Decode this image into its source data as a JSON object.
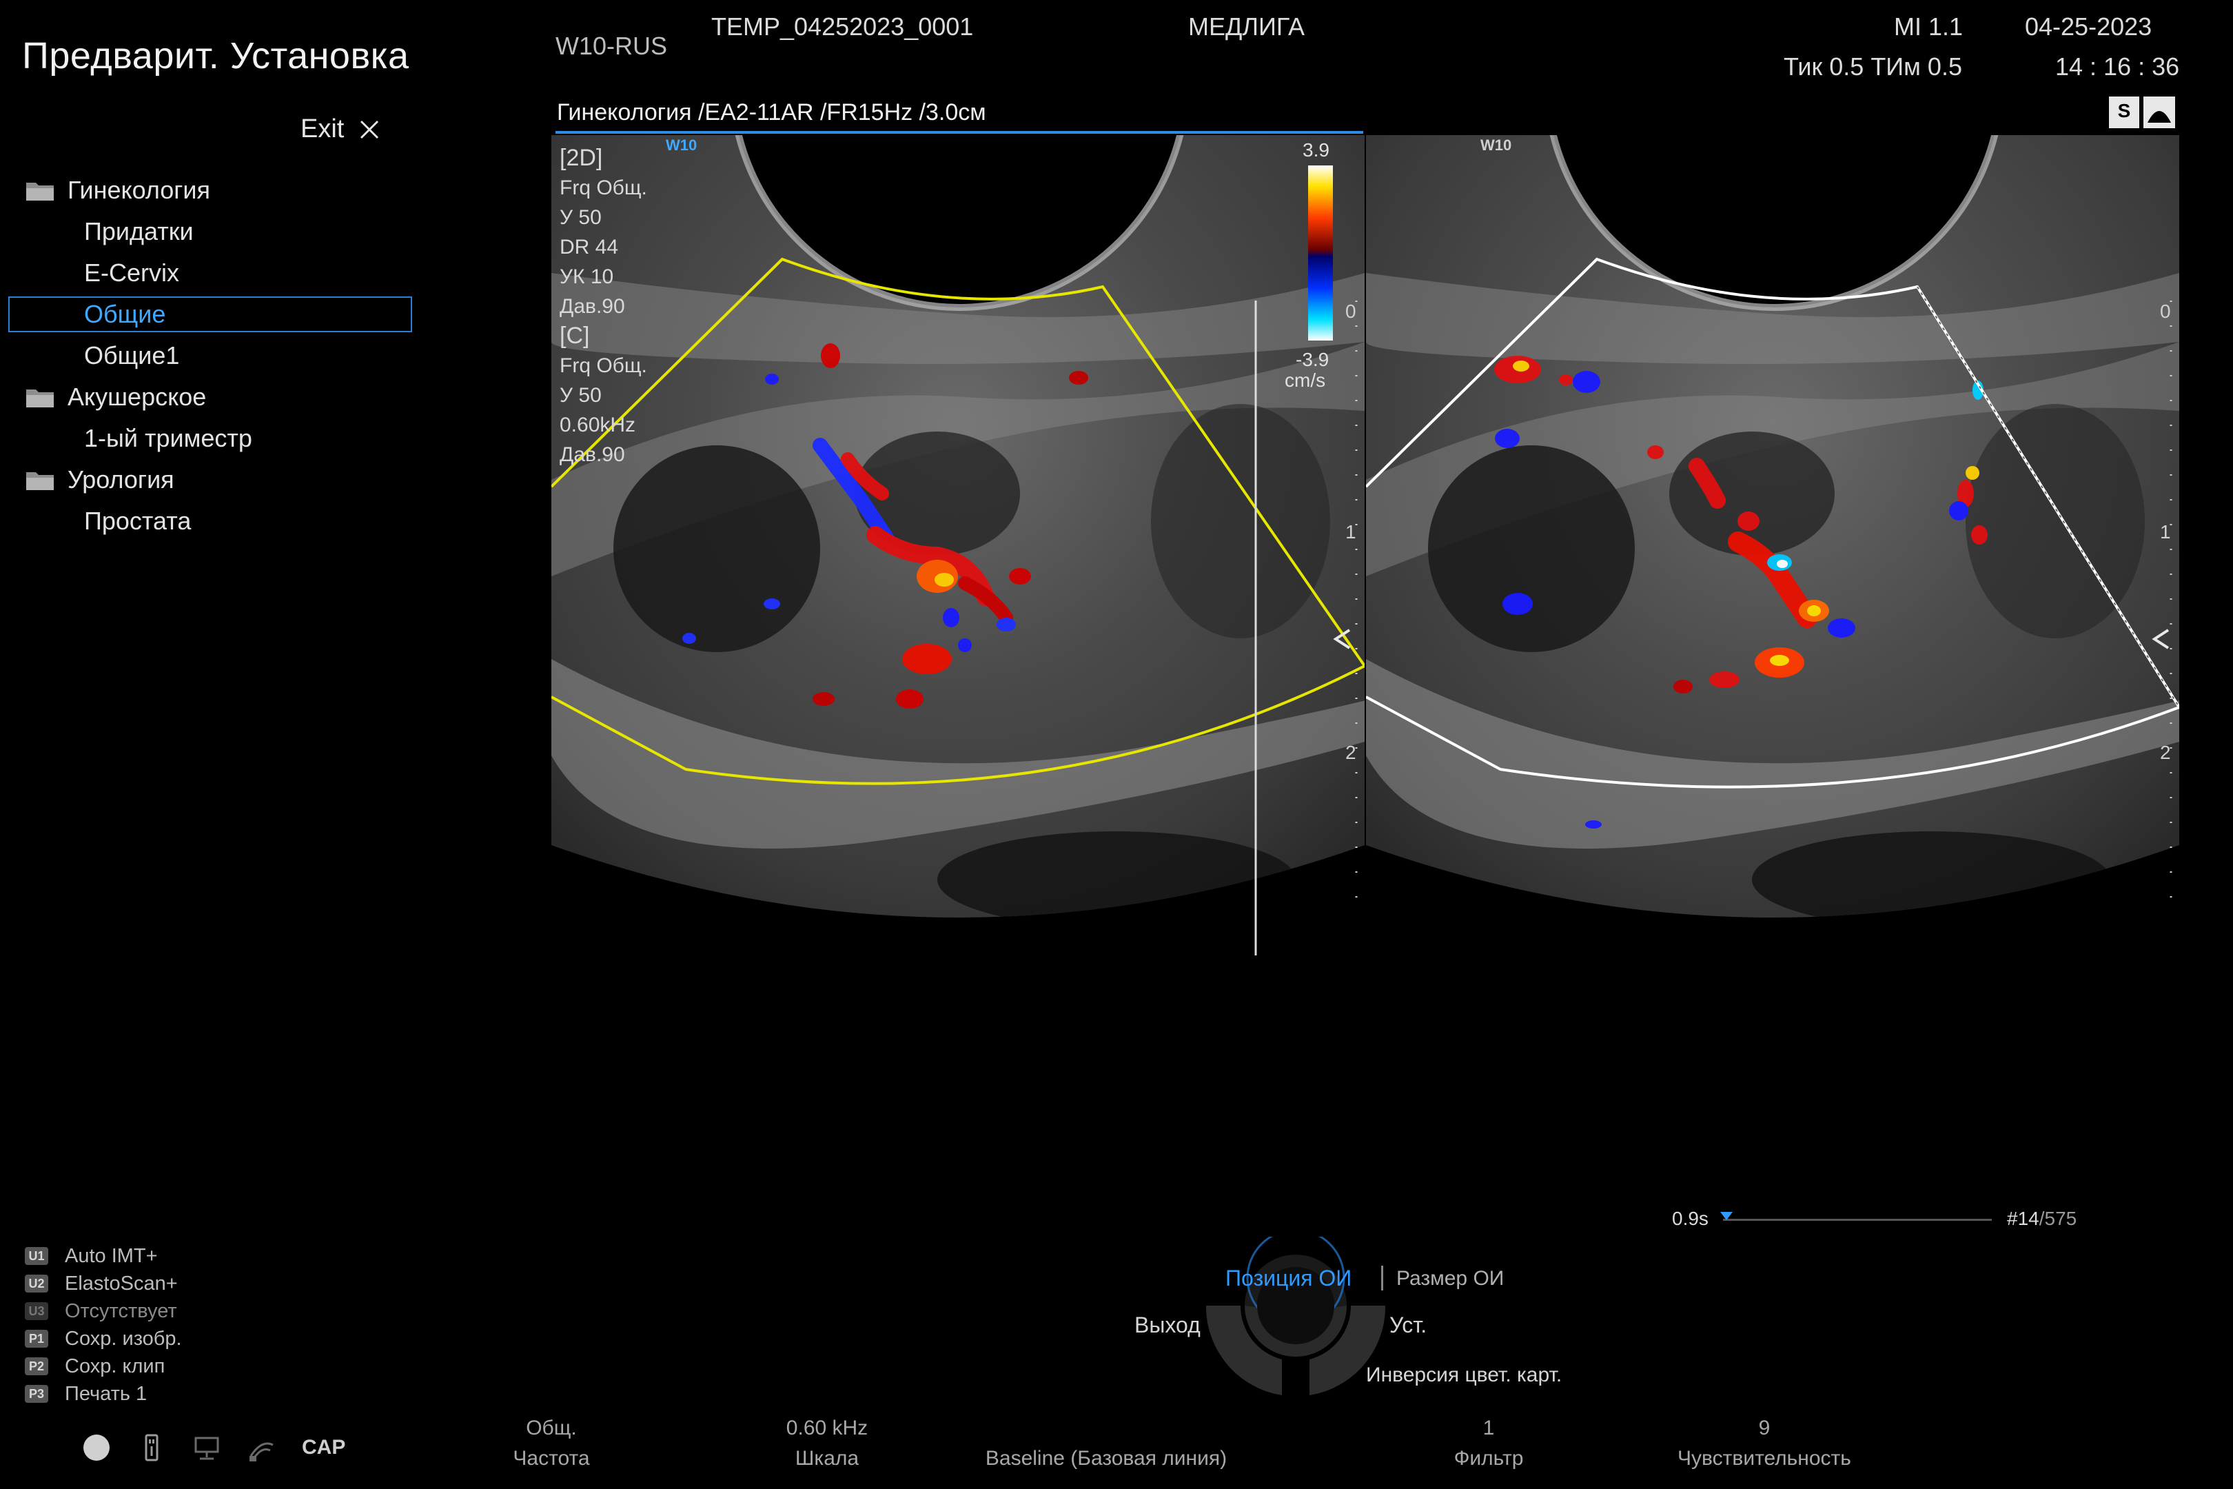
{
  "sidebar": {
    "title": "Предварит. Установка",
    "exit_label": "Exit",
    "tree": [
      {
        "type": "folder",
        "label": "Гинекология"
      },
      {
        "type": "leaf",
        "label": "Придатки"
      },
      {
        "type": "leaf",
        "label": "E-Cervix"
      },
      {
        "type": "leaf",
        "label": "Общие",
        "selected": true
      },
      {
        "type": "leaf",
        "label": "Общие1"
      },
      {
        "type": "folder",
        "label": "Акушерское"
      },
      {
        "type": "leaf",
        "label": "1-ый триместр"
      },
      {
        "type": "folder",
        "label": "Урология"
      },
      {
        "type": "leaf",
        "label": "Простата"
      }
    ],
    "user_keys": [
      {
        "key": "U1",
        "label": "Auto IMT+"
      },
      {
        "key": "U2",
        "label": "ElastoScan+"
      },
      {
        "key": "U3",
        "label": "Отсутствует"
      },
      {
        "key": "P1",
        "label": "Сохр. изобр."
      },
      {
        "key": "P2",
        "label": "Сохр. клип"
      },
      {
        "key": "P3",
        "label": "Печать 1"
      }
    ],
    "cap_label": "CAP"
  },
  "header": {
    "system": "W10-RUS",
    "patient_id": "TEMP_04252023_0001",
    "institution": "МЕДЛИГА",
    "mi": "MI  1.1",
    "ti": "Тик 0.5  ТИм 0.5",
    "date": "04-25-2023",
    "time": "14 : 16 : 36",
    "probe_line": "Гинекология /EA2-11AR /FR15Hz /3.0см"
  },
  "image_left": {
    "logo": "W10",
    "params_2d": {
      "heading": "[2D]",
      "lines": [
        "Frq  Общ.",
        "У     50",
        "DR   44",
        "УК   10",
        "Дав.90"
      ]
    },
    "params_color": {
      "heading": "[C]",
      "lines": [
        "Frq  Общ.",
        "У     50",
        "0.60kHz",
        "Дав.90"
      ]
    },
    "scale_top": "3.9",
    "scale_bottom": "-3.9",
    "scale_unit": "cm/s",
    "depth_marks": [
      "0",
      "1",
      "2"
    ]
  },
  "image_right": {
    "logo": "W10",
    "depth_marks": [
      "0",
      "1",
      "2"
    ]
  },
  "cine": {
    "time": "0.9s",
    "frame": "#14",
    "total": "/575",
    "progress": 0.024
  },
  "controls": {
    "position_roi": "Позиция ОИ",
    "size_roi": "Размер ОИ",
    "exit": "Выход",
    "set": "Уст.",
    "invert": "Инверсия цвет. карт."
  },
  "softkeys": [
    {
      "value": "Общ.",
      "label": "Частота"
    },
    {
      "value": "0.60 kHz",
      "label": "Шкала"
    },
    {
      "value": "",
      "label": "Baseline (Базовая линия)"
    },
    {
      "value": "1",
      "label": "Фильтр"
    },
    {
      "value": "9",
      "label": "Чувствительность"
    }
  ],
  "colors": {
    "accent": "#2f9bff",
    "roi_yellow": "#e6e600",
    "background": "#000000"
  }
}
